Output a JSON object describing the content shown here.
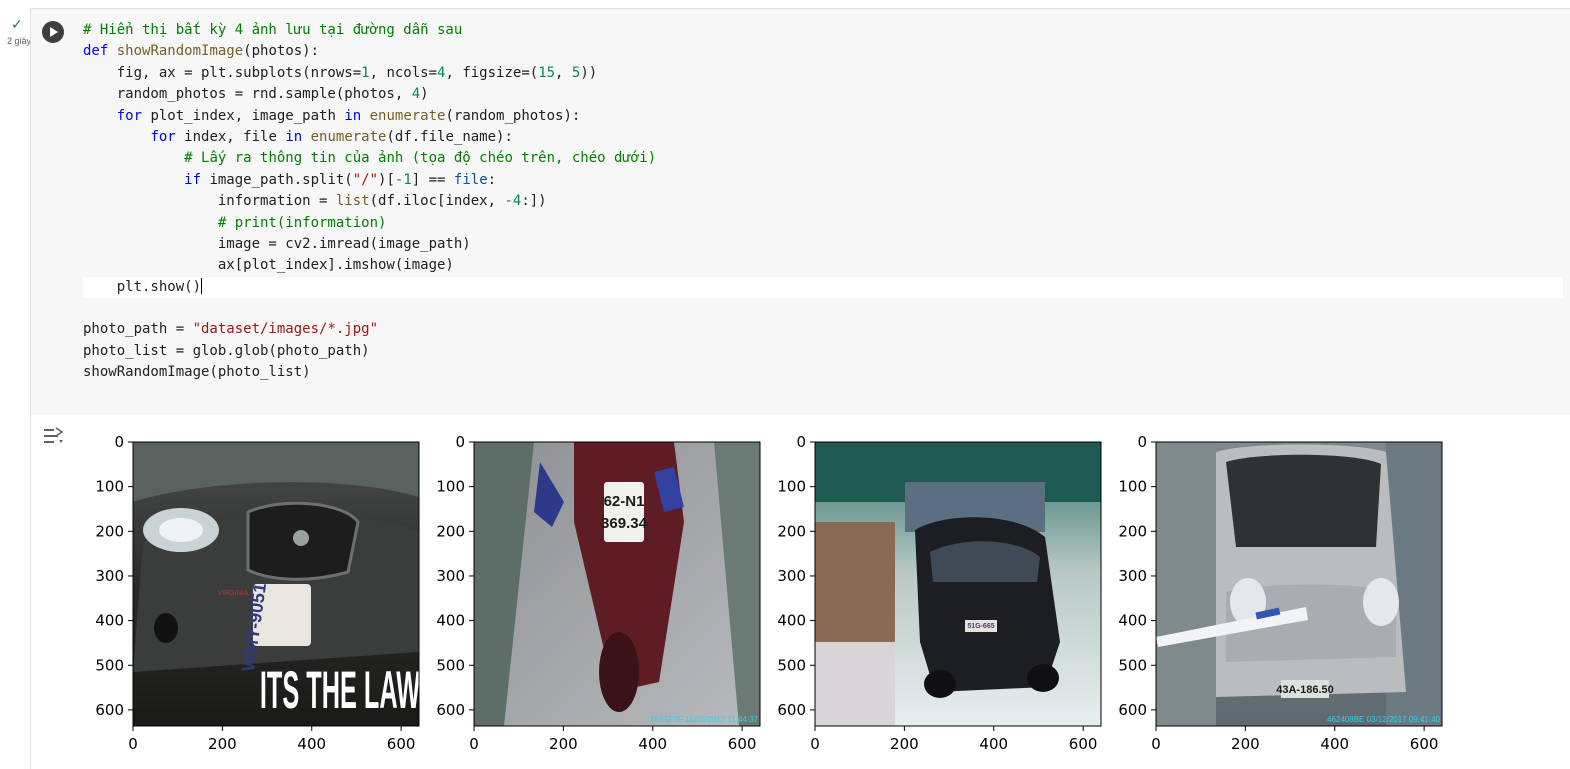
{
  "cell": {
    "status_check": "✓",
    "status_time": "2 giây",
    "run_icon": "play-icon"
  },
  "code": [
    [
      {
        "t": "# Hiển thị bất kỳ 4 ảnh lưu tại đường dẫn sau",
        "c": "cm"
      }
    ],
    [
      {
        "t": "def",
        "c": "kw"
      },
      {
        "t": " "
      },
      {
        "t": "showRandomImage",
        "c": "fn"
      },
      {
        "t": "(photos):"
      }
    ],
    [
      {
        "t": "    fig, ax = plt.subplots(nrows="
      },
      {
        "t": "1",
        "c": "nm"
      },
      {
        "t": ", ncols="
      },
      {
        "t": "4",
        "c": "nm"
      },
      {
        "t": ", figsize=("
      },
      {
        "t": "15",
        "c": "nm"
      },
      {
        "t": ", "
      },
      {
        "t": "5",
        "c": "nm"
      },
      {
        "t": "))"
      }
    ],
    [
      {
        "t": "    random_photos = rnd.sample(photos, "
      },
      {
        "t": "4",
        "c": "nm"
      },
      {
        "t": ")"
      }
    ],
    [
      {
        "t": "    "
      },
      {
        "t": "for",
        "c": "kw"
      },
      {
        "t": " plot_index, image_path "
      },
      {
        "t": "in",
        "c": "kw"
      },
      {
        "t": " "
      },
      {
        "t": "enumerate",
        "c": "fn"
      },
      {
        "t": "(random_photos):"
      }
    ],
    [
      {
        "t": "        "
      },
      {
        "t": "for",
        "c": "kw"
      },
      {
        "t": " index, file "
      },
      {
        "t": "in",
        "c": "kw"
      },
      {
        "t": " "
      },
      {
        "t": "enumerate",
        "c": "fn"
      },
      {
        "t": "(df.file_name):"
      }
    ],
    [
      {
        "t": "            "
      },
      {
        "t": "# Lấy ra thông tin của ảnh (tọa độ chéo trên, chéo dưới)",
        "c": "cm"
      }
    ],
    [
      {
        "t": "            "
      },
      {
        "t": "if",
        "c": "kw"
      },
      {
        "t": " image_path.split("
      },
      {
        "t": "\"/\"",
        "c": "st"
      },
      {
        "t": ")["
      },
      {
        "t": "-1",
        "c": "nm"
      },
      {
        "t": "] == "
      },
      {
        "t": "file",
        "c": "bl"
      },
      {
        "t": ":"
      }
    ],
    [
      {
        "t": "                information = "
      },
      {
        "t": "list",
        "c": "fn"
      },
      {
        "t": "(df.iloc[index, "
      },
      {
        "t": "-4",
        "c": "nm"
      },
      {
        "t": ":])"
      }
    ],
    [
      {
        "t": "                "
      },
      {
        "t": "# print(information)",
        "c": "cm"
      }
    ],
    [
      {
        "t": "                image = cv2.imread(image_path)"
      }
    ],
    [
      {
        "t": "                ax[plot_index].imshow(image)"
      }
    ],
    [
      {
        "t": "    plt.show()"
      },
      {
        "t": "",
        "cursor": true
      }
    ],
    [
      {
        "t": ""
      }
    ],
    [
      {
        "t": "photo_path = "
      },
      {
        "t": "\"dataset/images/*.jpg\"",
        "c": "st"
      }
    ],
    [
      {
        "t": "photo_list = glob.glob(photo_path)"
      }
    ],
    [
      {
        "t": "showRandomImage(photo_list)"
      }
    ]
  ],
  "output": {
    "icon": "output-toggle-icon",
    "subplots": [
      {
        "image_text": [
          "ITS THE LAW",
          "WMY-9051",
          "VIRGINIA"
        ],
        "scene": "car-front"
      },
      {
        "image_text": [
          "62-N1",
          "369.34",
          "16A5F0F 15/05/2017 11:44:37"
        ],
        "scene": "motorbike"
      },
      {
        "image_text": [
          "51G-665"
        ],
        "scene": "black-suv"
      },
      {
        "image_text": [
          "43A-186.50",
          "462408BE 03/12/2017 09:41:40"
        ],
        "scene": "silver-minivan"
      }
    ],
    "x_ticks": [
      "0",
      "200",
      "400",
      "600"
    ],
    "y_ticks": [
      "0",
      "100",
      "200",
      "300",
      "400",
      "500",
      "600"
    ]
  }
}
